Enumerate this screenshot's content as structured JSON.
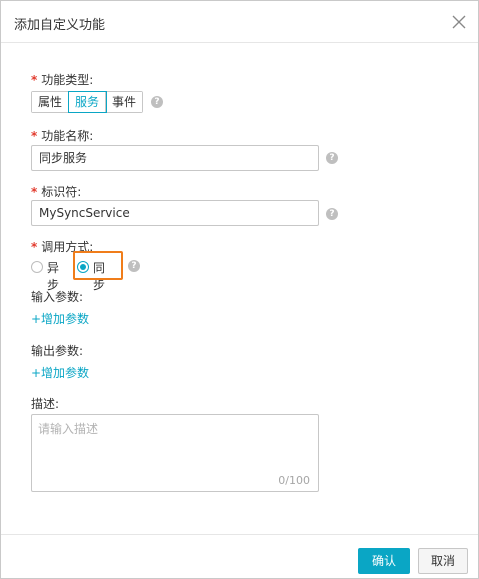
{
  "dialog": {
    "title": "添加自定义功能"
  },
  "form": {
    "function_type": {
      "label": "功能类型:",
      "options": [
        "属性",
        "服务",
        "事件"
      ],
      "selected": "服务"
    },
    "function_name": {
      "label": "功能名称:",
      "value": "同步服务"
    },
    "identifier": {
      "label": "标识符:",
      "value": "MySyncService"
    },
    "call_mode": {
      "label": "调用方式:",
      "options": [
        "异步",
        "同步"
      ],
      "selected": "同步"
    },
    "input_params": {
      "label": "输入参数:",
      "add_link": "+增加参数"
    },
    "output_params": {
      "label": "输出参数:",
      "add_link": "+增加参数"
    },
    "description": {
      "label": "描述:",
      "placeholder": "请输入描述",
      "counter": "0/100"
    }
  },
  "footer": {
    "confirm_label": "确认",
    "cancel_label": "取消"
  },
  "required_mark": "*",
  "help_glyph": "?",
  "colors": {
    "accent": "#0aa6c5",
    "required": "#e23b2e",
    "highlight": "#f07d1a"
  }
}
